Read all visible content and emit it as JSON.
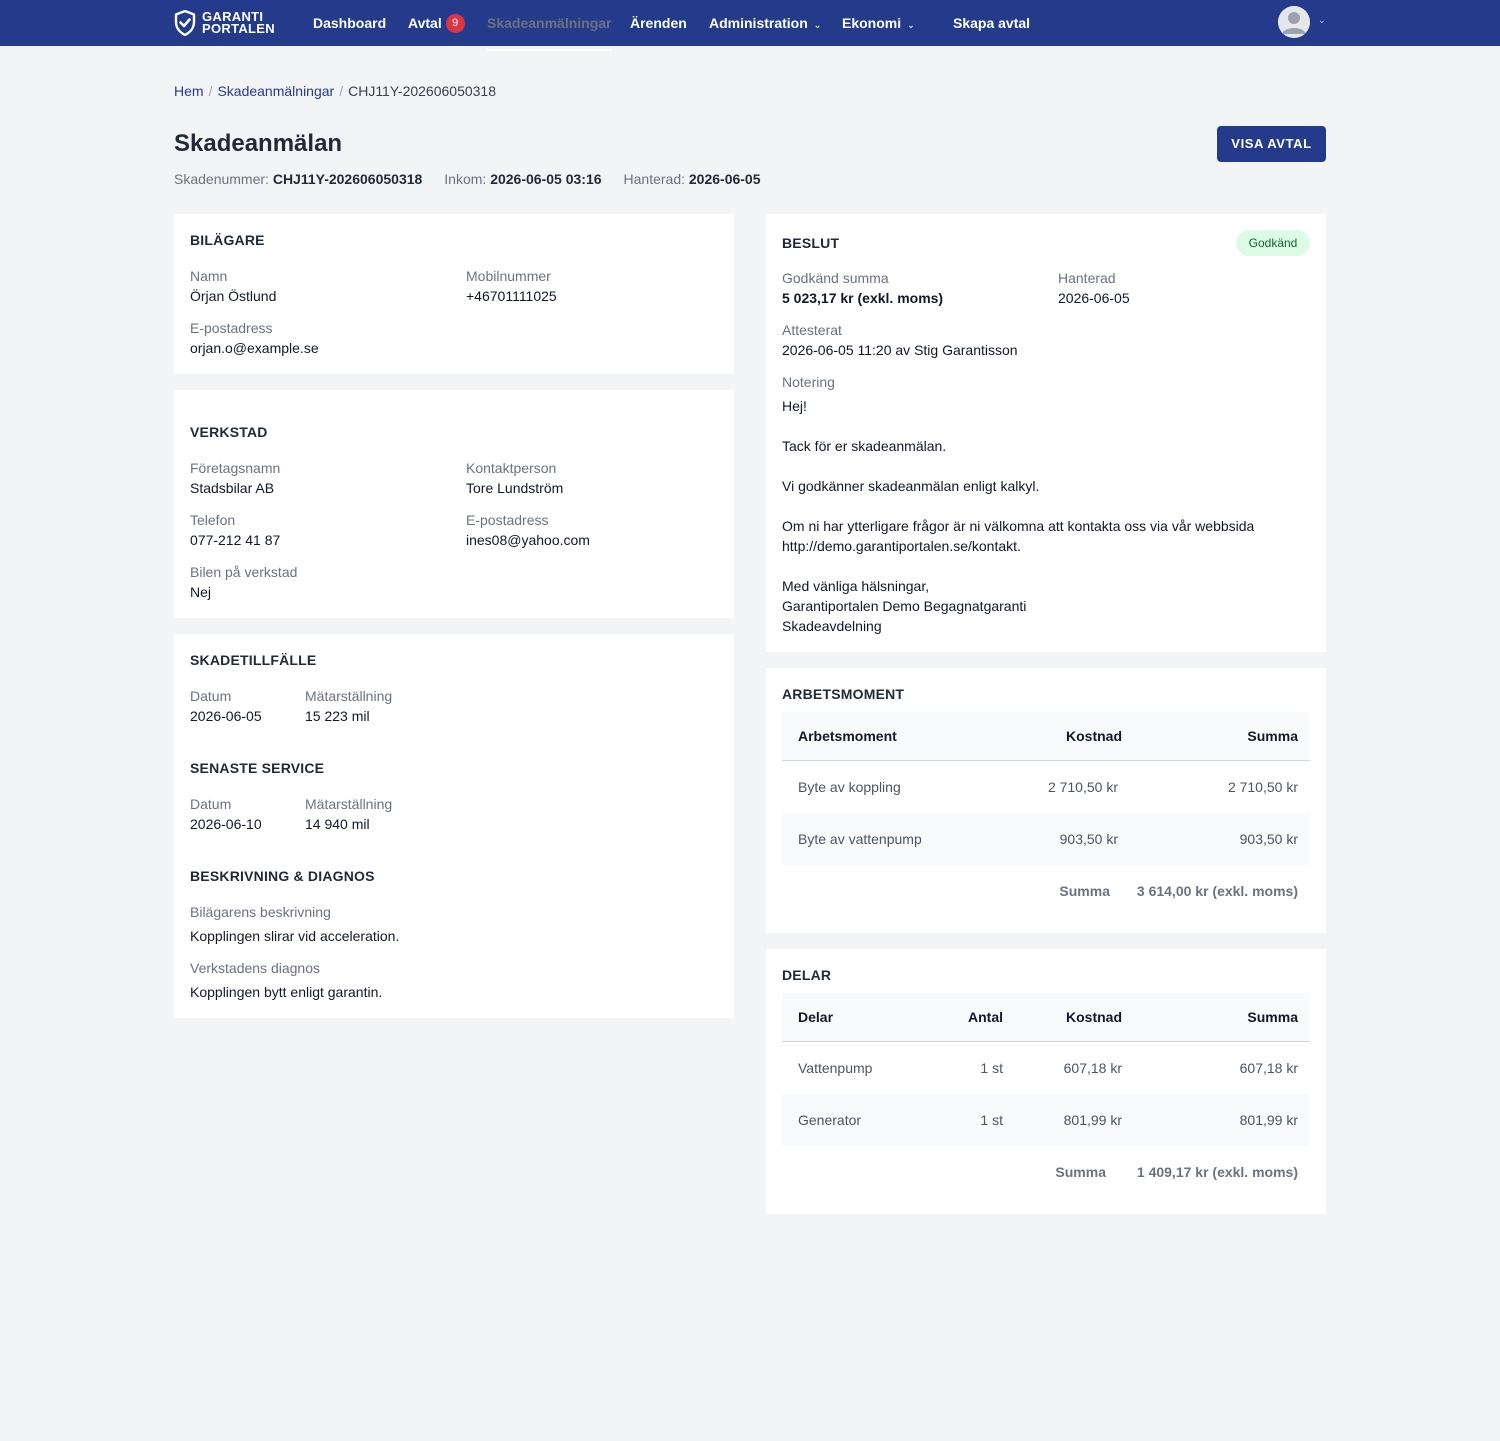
{
  "nav": {
    "logo_line1": "GARANTI",
    "logo_line2": "PORTALEN",
    "dashboard": "Dashboard",
    "avtal": "Avtal",
    "avtal_badge": "9",
    "skadeanmalningar": "Skadeanmälningar",
    "arenden": "Ärenden",
    "administration": "Administration",
    "ekonomi": "Ekonomi",
    "skapa_avtal": "Skapa avtal"
  },
  "breadcrumb": {
    "home": "Hem",
    "section": "Skadeanmälningar",
    "current": "CHJ11Y-202606050318"
  },
  "header": {
    "title": "Skadeanmälan",
    "visa_avtal": "VISA AVTAL",
    "skadenummer_label": "Skadenummer:",
    "skadenummer": "CHJ11Y-202606050318",
    "inkom_label": "Inkom:",
    "inkom": "2026-06-05 03:16",
    "hanterad_label": "Hanterad:",
    "hanterad": "2026-06-05"
  },
  "bilagare": {
    "heading": "BILÄGARE",
    "namn_label": "Namn",
    "namn": "Örjan Östlund",
    "mobil_label": "Mobilnummer",
    "mobil": "+46701111025",
    "epost_label": "E-postadress",
    "epost": "orjan.o@example.se"
  },
  "verkstad": {
    "heading": "VERKSTAD",
    "foretag_label": "Företagsnamn",
    "foretag": "Stadsbilar AB",
    "kontakt_label": "Kontaktperson",
    "kontakt": "Tore Lundström",
    "telefon_label": "Telefon",
    "telefon": "077-212 41 87",
    "epost_label": "E-postadress",
    "epost": "ines08@yahoo.com",
    "bilen_label": "Bilen på verkstad",
    "bilen": "Nej"
  },
  "skadetillfalle": {
    "heading": "SKADETILLFÄLLE",
    "datum_label": "Datum",
    "datum": "2026-06-05",
    "matar_label": "Mätarställning",
    "matar": "15 223 mil",
    "service_heading": "SENASTE SERVICE",
    "service_datum_label": "Datum",
    "service_datum": "2026-06-10",
    "service_matar_label": "Mätarställning",
    "service_matar": "14 940 mil",
    "beskrivning_heading": "BESKRIVNING & DIAGNOS",
    "bilagarens_label": "Bilägarens beskrivning",
    "bilagarens": "Kopplingen slirar vid acceleration.",
    "verkstadens_label": "Verkstadens diagnos",
    "verkstadens": "Kopplingen bytt enligt garantin."
  },
  "beslut": {
    "heading": "BESLUT",
    "status": "Godkänd",
    "summa_label": "Godkänd summa",
    "summa": "5 023,17 kr (exkl. moms)",
    "hanterad_label": "Hanterad",
    "hanterad": "2026-06-05",
    "attesterat_label": "Attesterat",
    "attesterat": "2026-06-05 11:20 av Stig Garantisson",
    "notering_label": "Notering",
    "notering_lines": [
      "Hej!",
      "Tack för er skadeanmälan.",
      "Vi godkänner skadeanmälan enligt kalkyl.",
      "Om ni har ytterligare frågor är ni välkomna att kontakta oss via vår webbsida",
      "http://demo.garantiportalen.se/kontakt.",
      "Med vänliga hälsningar,",
      "Garantiportalen Demo Begagnatgaranti",
      "Skadeavdelning"
    ]
  },
  "arbetsmoment": {
    "heading": "ARBETSMOMENT",
    "col_name": "Arbetsmoment",
    "col_kostnad": "Kostnad",
    "col_summa": "Summa",
    "rows": [
      {
        "name": "Byte av koppling",
        "kostnad": "2 710,50 kr",
        "summa": "2 710,50 kr"
      },
      {
        "name": "Byte av vattenpump",
        "kostnad": "903,50 kr",
        "summa": "903,50 kr"
      }
    ],
    "total_label": "Summa",
    "total": "3 614,00 kr (exkl. moms)"
  },
  "delar": {
    "heading": "DELAR",
    "col_name": "Delar",
    "col_antal": "Antal",
    "col_kostnad": "Kostnad",
    "col_summa": "Summa",
    "rows": [
      {
        "name": "Vattenpump",
        "antal": "1 st",
        "kostnad": "607,18 kr",
        "summa": "607,18 kr"
      },
      {
        "name": "Generator",
        "antal": "1 st",
        "kostnad": "801,99 kr",
        "summa": "801,99 kr"
      }
    ],
    "total_label": "Summa",
    "total": "1 409,17 kr (exkl. moms)"
  }
}
